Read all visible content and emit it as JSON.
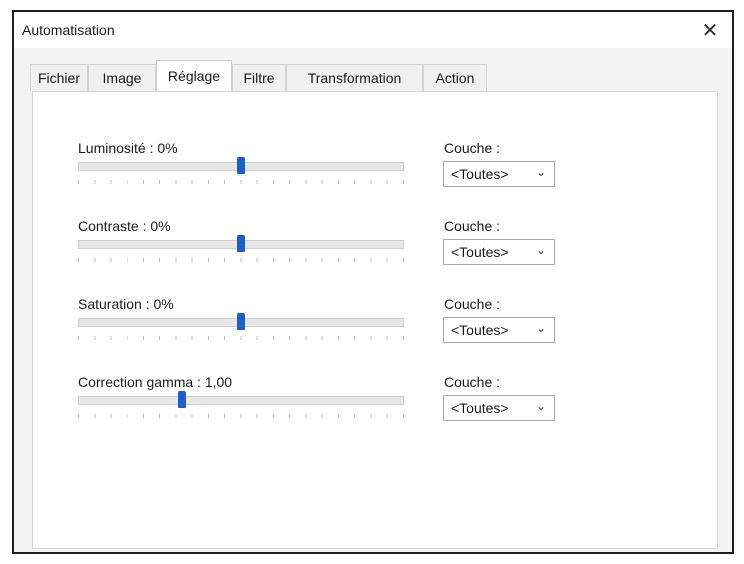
{
  "window": {
    "title": "Automatisation",
    "close_glyph": "✕"
  },
  "tabs": [
    {
      "label": "Fichier",
      "active": false
    },
    {
      "label": "Image",
      "active": false
    },
    {
      "label": "Réglage",
      "active": true
    },
    {
      "label": "Filtre",
      "active": false
    },
    {
      "label": "Transformation",
      "active": false
    },
    {
      "label": "Action",
      "active": false
    }
  ],
  "adjustments": [
    {
      "label": "Luminosité : 0%",
      "value": 0.5,
      "layer_label": "Couche :",
      "layer_value": "<Toutes>"
    },
    {
      "label": "Contraste : 0%",
      "value": 0.5,
      "layer_label": "Couche :",
      "layer_value": "<Toutes>"
    },
    {
      "label": "Saturation : 0%",
      "value": 0.5,
      "layer_label": "Couche :",
      "layer_value": "<Toutes>"
    },
    {
      "label": "Correction gamma : 1,00",
      "value": 0.32,
      "layer_label": "Couche :",
      "layer_value": "<Toutes>"
    }
  ],
  "icons": {
    "close": "close-icon",
    "dropdown": "chevron-down-icon"
  },
  "colors": {
    "accent": "#1f5fbf",
    "panel": "#ffffff",
    "window_bg": "#f3f3f3"
  }
}
